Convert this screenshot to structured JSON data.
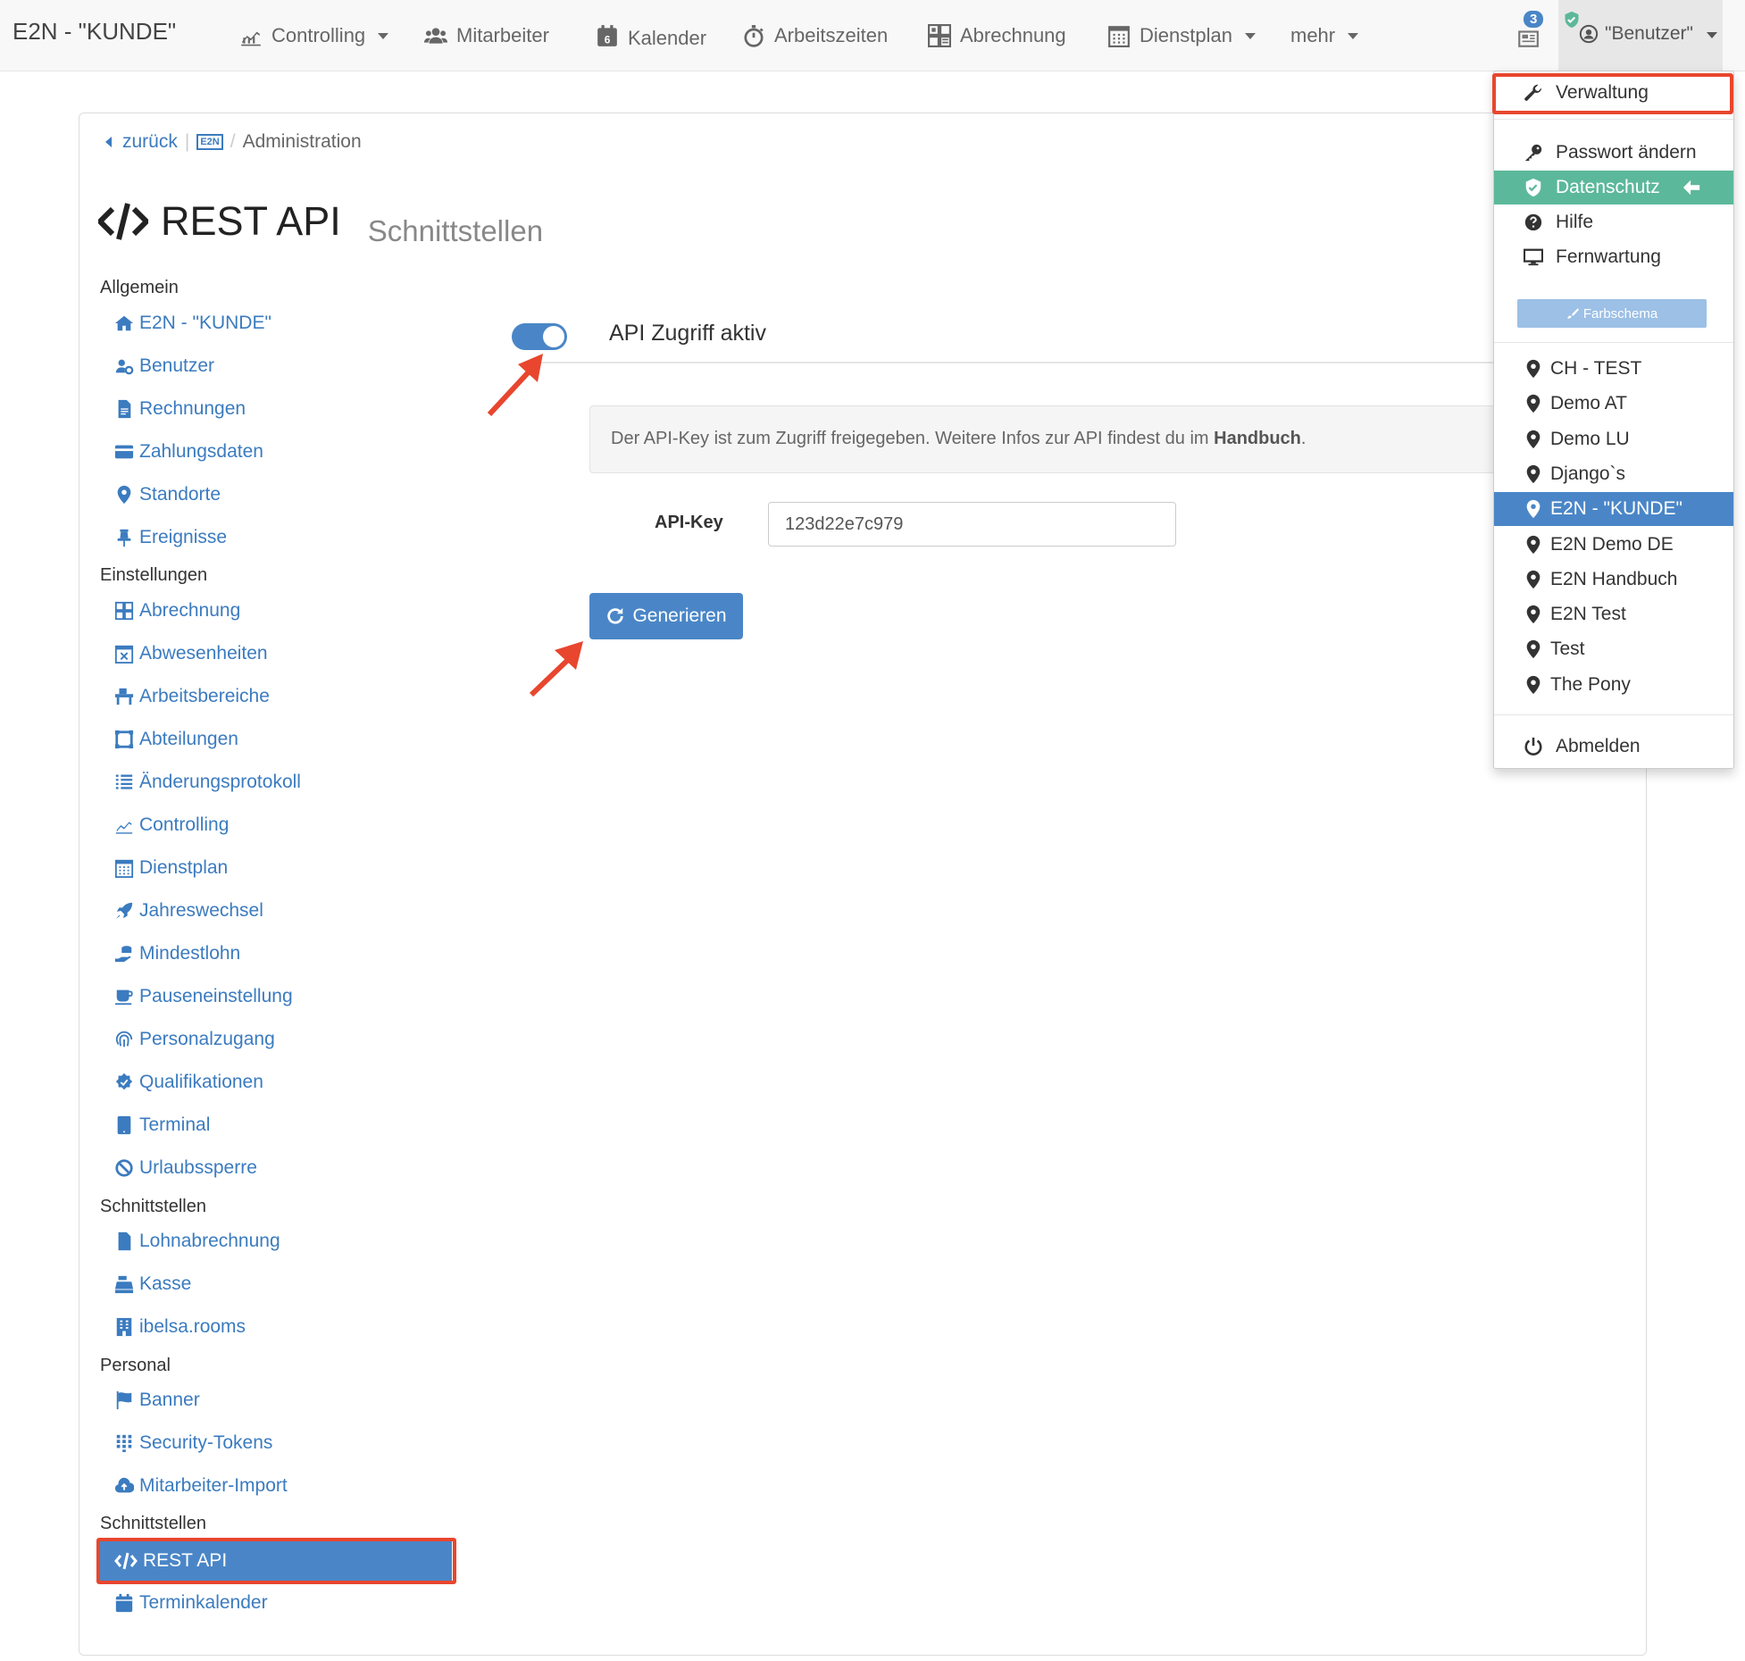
{
  "navbar": {
    "brand": "E2N - \"KUNDE\"",
    "items": {
      "controlling": "Controlling",
      "mitarbeiter": "Mitarbeiter",
      "kalender": "Kalender",
      "kalender_day": "6",
      "arbeitszeiten": "Arbeitszeiten",
      "abrechnung": "Abrechnung",
      "dienstplan": "Dienstplan",
      "mehr": "mehr"
    },
    "notification_count": "3",
    "user": "\"Benutzer\""
  },
  "breadcrumb": {
    "back": "zurück",
    "logo_text": "E2N",
    "current": "Administration"
  },
  "page": {
    "title": "REST API",
    "subtitle": "Schnittstellen"
  },
  "sidebar": {
    "sections": [
      {
        "title": "Allgemein",
        "items": [
          {
            "label": "E2N - \"KUNDE\"",
            "icon": "home-icon"
          },
          {
            "label": "Benutzer",
            "icon": "users-icon"
          },
          {
            "label": "Rechnungen",
            "icon": "file-icon"
          },
          {
            "label": "Zahlungsdaten",
            "icon": "credit-card-icon"
          },
          {
            "label": "Standorte",
            "icon": "map-marker-icon"
          },
          {
            "label": "Ereignisse",
            "icon": "pin-icon"
          }
        ]
      },
      {
        "title": "Einstellungen",
        "items": [
          {
            "label": "Abrechnung",
            "icon": "abrechnung-icon"
          },
          {
            "label": "Abwesenheiten",
            "icon": "calendar-x-icon"
          },
          {
            "label": "Arbeitsbereiche",
            "icon": "desk-icon"
          },
          {
            "label": "Abteilungen",
            "icon": "frame-icon"
          },
          {
            "label": "Änderungsprotokoll",
            "icon": "list-icon"
          },
          {
            "label": "Controlling",
            "icon": "chart-icon"
          },
          {
            "label": "Dienstplan",
            "icon": "calendar-grid-icon"
          },
          {
            "label": "Jahreswechsel",
            "icon": "rocket-icon"
          },
          {
            "label": "Mindestlohn",
            "icon": "coins-hand-icon"
          },
          {
            "label": "Pauseneinstellung",
            "icon": "coffee-icon"
          },
          {
            "label": "Personalzugang",
            "icon": "fingerprint-icon"
          },
          {
            "label": "Qualifikationen",
            "icon": "certificate-icon"
          },
          {
            "label": "Terminal",
            "icon": "tablet-icon"
          },
          {
            "label": "Urlaubssperre",
            "icon": "ban-icon"
          }
        ]
      },
      {
        "title": "Schnittstellen",
        "items": [
          {
            "label": "Lohnabrechnung",
            "icon": "file-icon"
          },
          {
            "label": "Kasse",
            "icon": "cash-register-icon"
          },
          {
            "label": "ibelsa.rooms",
            "icon": "building-icon"
          }
        ]
      },
      {
        "title": "Personal",
        "items": [
          {
            "label": "Banner",
            "icon": "flag-icon"
          },
          {
            "label": "Security-Tokens",
            "icon": "keypad-icon"
          },
          {
            "label": "Mitarbeiter-Import",
            "icon": "cloud-upload-icon"
          }
        ]
      },
      {
        "title": "Schnittstellen",
        "items": [
          {
            "label": "REST API",
            "icon": "code-icon"
          },
          {
            "label": "Terminkalender",
            "icon": "calendar-icon"
          }
        ]
      }
    ]
  },
  "content": {
    "toggle_label": "API Zugriff aktiv",
    "toggle_on": true,
    "info_text": "Der API-Key ist zum Zugriff freigegeben. Weitere Infos zur API findest du im ",
    "info_link": "Handbuch",
    "info_end": ".",
    "api_key_label": "API-Key",
    "api_key_value": "123d22e7c979",
    "generate_button": "Generieren"
  },
  "dropdown": {
    "verwaltung": "Verwaltung",
    "passwort": "Passwort ändern",
    "datenschutz": "Datenschutz",
    "hilfe": "Hilfe",
    "fernwartung": "Fernwartung",
    "farbschema": "Farbschema",
    "locations": [
      "CH - TEST",
      "Demo AT",
      "Demo LU",
      "Django`s",
      "E2N - \"KUNDE\"",
      "E2N Demo DE",
      "E2N Handbuch",
      "E2N Test",
      "Test",
      "The Pony"
    ],
    "active_location": "E2N - \"KUNDE\"",
    "abmelden": "Abmelden"
  },
  "colors": {
    "primary": "#4a86c7",
    "link": "#3b7bbf",
    "highlight_green": "#5cb89a",
    "annotation_red": "#e8462e"
  }
}
